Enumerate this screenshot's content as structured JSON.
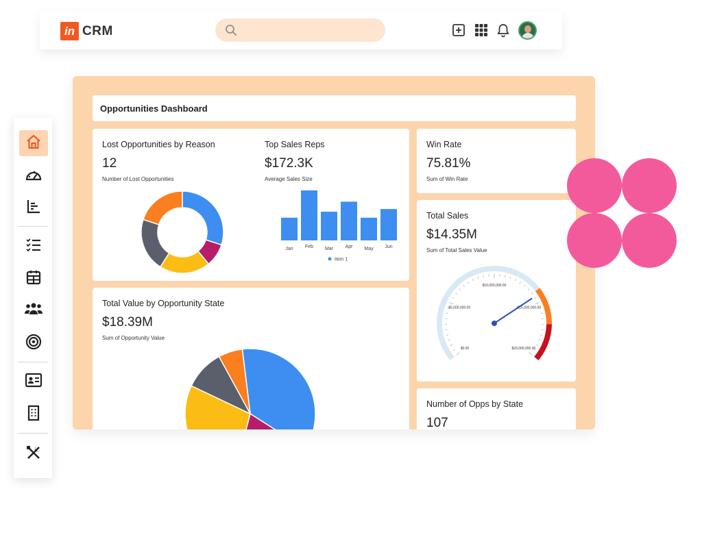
{
  "app": {
    "logo_mark": "in",
    "logo_text": "CRM"
  },
  "topbar": {
    "search_placeholder": "",
    "icons": [
      "search-icon",
      "add-icon",
      "apps-grid-icon",
      "bell-icon",
      "user-avatar"
    ]
  },
  "sidebar": {
    "items": [
      "home-icon",
      "dashboard-gauge-icon",
      "reports-icon",
      "tasks-icon",
      "calendar-icon",
      "contacts-icon",
      "target-icon",
      "id-card-icon",
      "building-icon",
      "tools-icon"
    ],
    "active": "home-icon"
  },
  "colors": {
    "accent": "#f05a22",
    "frame": "#fcd5ad",
    "blue": "#3d8ef0",
    "orange": "#fb7e1f",
    "slate": "#5b5f6b",
    "yellow": "#fbbd14",
    "magenta": "#b71d68",
    "pink": "#f35a9c"
  },
  "dashboard": {
    "title": "Opportunities Dashboard",
    "lost": {
      "title": "Lost Opportunities by Reason",
      "value": "12",
      "subtitle": "Number of Lost Opportunities"
    },
    "top_reps": {
      "title": "Top Sales Reps",
      "value": "$172.3K",
      "subtitle": "Average Sales Size"
    },
    "win_rate": {
      "title": "Win Rate",
      "value": "75.81%",
      "subtitle": "Sum of Win Rate"
    },
    "total_sales": {
      "title": "Total Sales",
      "value": "$14.35M",
      "subtitle": "Sum of Total Sales Value"
    },
    "total_value": {
      "title": "Total Value by Opportunity State",
      "value": "$18.39M",
      "subtitle": "Sum of Opportunity Value"
    },
    "opps_by_state": {
      "title": "Number of Opps by State",
      "value": "107"
    }
  },
  "chart_data": [
    {
      "type": "pie",
      "variant": "donut",
      "title": "Lost Opportunities by Reason",
      "values": [
        30,
        9,
        20,
        21,
        20
      ],
      "colors": [
        "#3d8ef0",
        "#b71d68",
        "#fbbd14",
        "#5b5f6b",
        "#fb7e1f"
      ]
    },
    {
      "type": "bar",
      "title": "Top Sales Reps",
      "categories": [
        "Jan",
        "Feb",
        "Mar",
        "Apr",
        "May",
        "Jun"
      ],
      "series": [
        {
          "name": "Item 1",
          "values": [
            34,
            75,
            43,
            58,
            34,
            47
          ]
        }
      ],
      "ylim": [
        0,
        80
      ],
      "grid": false,
      "legend": "bottom",
      "color": "#3d8ef0"
    },
    {
      "type": "gauge",
      "title": "Total Sales",
      "min_label": "$0.00",
      "ticks": [
        "$0.00",
        "$5,000,000.00",
        "$10,000,000.00",
        "$15,000,000.00",
        "$20,000,000.00"
      ],
      "range": [
        0,
        20000000
      ],
      "value": 14350000
    },
    {
      "type": "pie",
      "title": "Total Value by Opportunity State",
      "values": [
        36,
        20,
        28,
        10,
        6
      ],
      "colors": [
        "#3d8ef0",
        "#b71d68",
        "#fbbd14",
        "#5b5f6b",
        "#fb7e1f"
      ]
    }
  ]
}
